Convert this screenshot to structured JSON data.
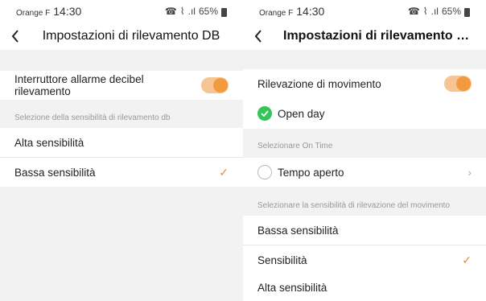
{
  "left": {
    "status": {
      "carrier": "Orange F",
      "time": "14:30",
      "battery": "65%"
    },
    "title": "Impostazioni di rilevamento DB",
    "alarm_switch": {
      "label": "Interruttore allarme decibel rilevamento",
      "on": true
    },
    "section_label": "Selezione della sensibilità di rilevamento db",
    "options": [
      {
        "label": "Alta sensibilità",
        "selected": false
      },
      {
        "label": "Bassa sensibilità",
        "selected": true
      }
    ]
  },
  "right": {
    "status": {
      "carrier": "Orange F",
      "time": "14:30",
      "battery": "65%"
    },
    "title": "Impostazioni di rilevamento di m...",
    "motion_switch": {
      "label": "Rilevazione di movimento",
      "on": true
    },
    "open_day": {
      "label": "Open day",
      "checked": true
    },
    "on_time_label": "Selezionare On Time",
    "tempo": {
      "label": "Tempo aperto",
      "checked": false
    },
    "sensitivity_label": "Selezionare la sensibilità di rilevazione del movimento",
    "options": [
      {
        "label": "Bassa sensibilità",
        "selected": false
      },
      {
        "label": "Sensibilità",
        "selected": true
      },
      {
        "label": "Alta sensibilità",
        "selected": false
      }
    ]
  },
  "colors": {
    "accent": "#f19a3e",
    "green": "#35c659"
  },
  "icons": {
    "back": "chevron-left-icon",
    "check": "checkmark-icon",
    "chevron": "chevron-right-icon"
  }
}
